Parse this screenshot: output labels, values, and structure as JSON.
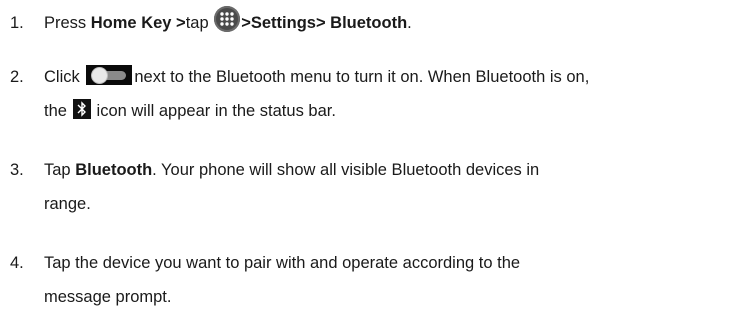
{
  "steps": [
    {
      "number": "1.",
      "parts": {
        "a": "Press ",
        "b": "Home Key >",
        "c": "tap ",
        "d": ">Settings> Bluetooth",
        "e": "."
      }
    },
    {
      "number": "2.",
      "parts": {
        "a": "Click ",
        "b": "next to the Bluetooth menu to turn it on. When Bluetooth is on,",
        "c": "the ",
        "d": "icon will appear in the status bar."
      }
    },
    {
      "number": "3.",
      "parts": {
        "a": "Tap ",
        "b": "Bluetooth",
        "c": ". Your phone will show all visible Bluetooth devices in",
        "d": "range."
      }
    },
    {
      "number": "4.",
      "parts": {
        "a": "Tap the device you want to pair with and operate according to the",
        "b": "message prompt."
      }
    }
  ],
  "icons": {
    "apps": "apps-grid-icon",
    "toggle": "toggle-switch-icon",
    "bluetooth": "bluetooth-icon"
  }
}
